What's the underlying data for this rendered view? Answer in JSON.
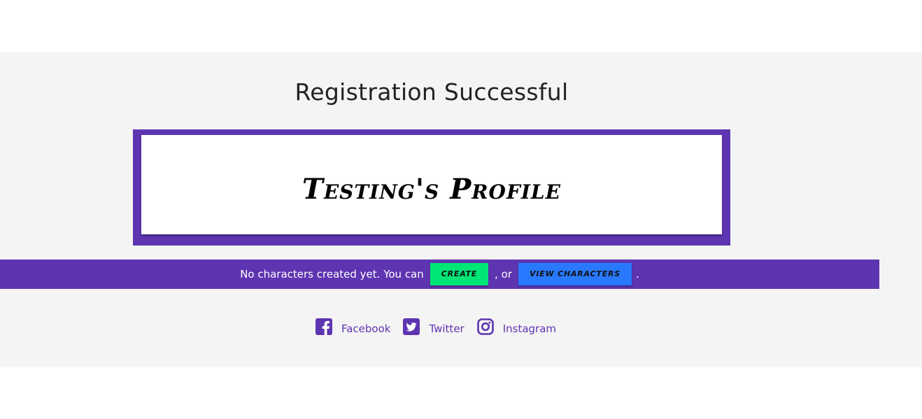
{
  "page": {
    "title": "Registration Successful"
  },
  "profile": {
    "heading": "Testing's Profile"
  },
  "notice": {
    "text_before": "No characters created yet. You can",
    "create_label": "create",
    "text_between": ", or",
    "view_label": "view characters",
    "text_after": "."
  },
  "social": {
    "links": [
      {
        "label": "Facebook",
        "icon": "facebook-square-icon"
      },
      {
        "label": "Twitter",
        "icon": "twitter-square-icon"
      },
      {
        "label": "Instagram",
        "icon": "instagram-icon"
      }
    ]
  },
  "colors": {
    "accent": "#5e35b1",
    "create_button": "#00e676",
    "view_button": "#2979ff",
    "section_bg": "#f4f4f4"
  }
}
